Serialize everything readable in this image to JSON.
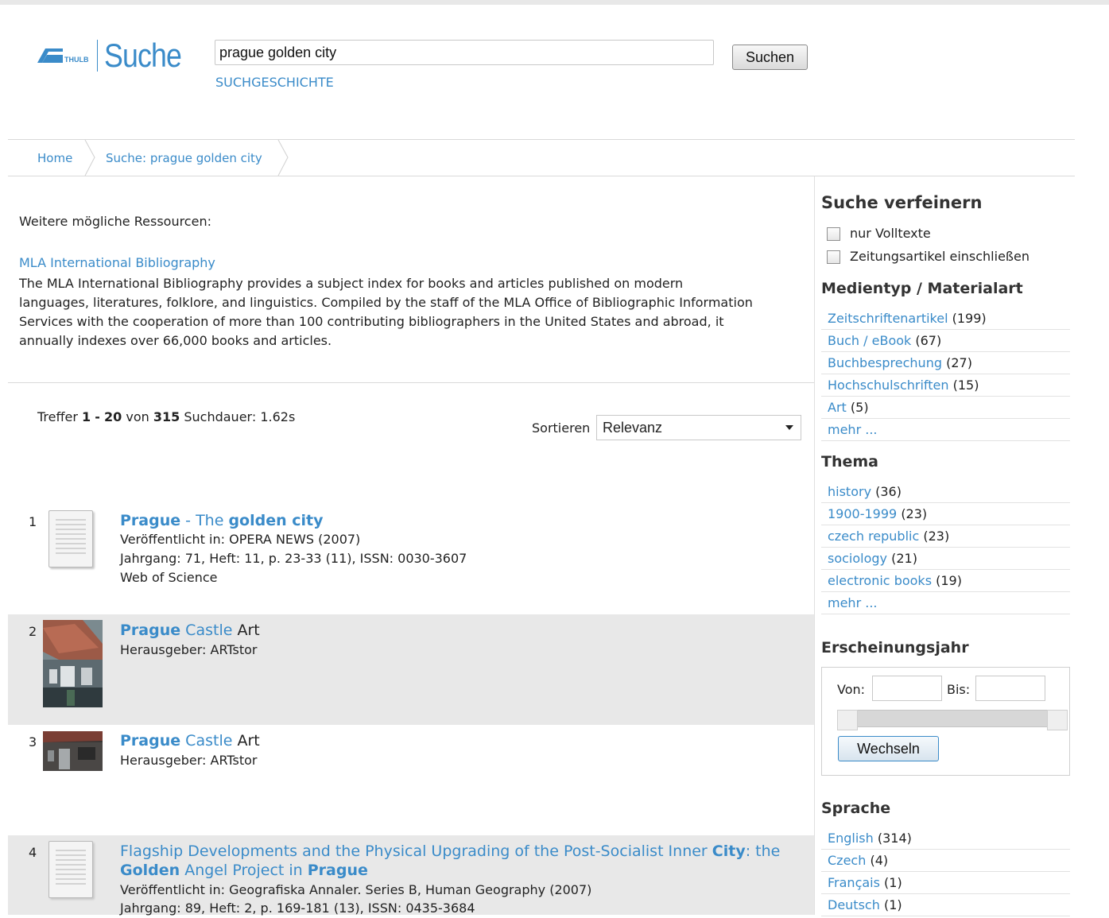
{
  "header": {
    "logo_brand": "THULB",
    "logo_text": "Suche",
    "search_value": "prague golden city",
    "search_button": "Suchen",
    "history_link": "SUCHGESCHICHTE"
  },
  "breadcrumb": [
    "Home",
    "Suche: prague golden city"
  ],
  "resources": {
    "heading": "Weitere mögliche Ressourcen:",
    "link": "MLA International Bibliography",
    "description": [
      "The MLA International Bibliography provides a subject index for books and articles published on modern",
      "languages, literatures, folklore, and linguistics. Compiled by the staff of the MLA Office of Bibliographic Information",
      "Services with the cooperation of more than 100 contributing bibliographers in the United States and abroad, it",
      "annually indexes over 66,000 books and articles."
    ]
  },
  "results_info": {
    "label": "Treffer",
    "from": "1",
    "dash": "-",
    "to": "20",
    "of_label": "von",
    "total": "315",
    "duration_label": "Suchdauer:",
    "duration": "1.62s",
    "sort_label": "Sortieren",
    "sort_value": "Relevanz"
  },
  "results": [
    {
      "num": "1",
      "thumb": "document-icon",
      "title": [
        {
          "text": "Prague",
          "style": "bold"
        },
        {
          "text": " - The ",
          "style": "link"
        },
        {
          "text": "golden city",
          "style": "bold"
        }
      ],
      "lines": [
        "Veröffentlicht in: OPERA NEWS (2007)",
        "Jahrgang: 71, Heft: 11, p. 23-33 (11), ISSN: 0030-3607",
        "Web of Science"
      ]
    },
    {
      "num": "2",
      "thumb": "prague-castle-photo",
      "title": [
        {
          "text": "Prague",
          "style": "bold"
        },
        {
          "text": " Castle",
          "style": "link"
        },
        {
          "text": " Art",
          "style": "plain"
        }
      ],
      "lines": [
        "Herausgeber: ARTstor"
      ]
    },
    {
      "num": "3",
      "thumb": "prague-castle-photo",
      "title": [
        {
          "text": "Prague",
          "style": "bold"
        },
        {
          "text": " Castle",
          "style": "link"
        },
        {
          "text": " Art",
          "style": "plain"
        }
      ],
      "lines": [
        "Herausgeber: ARTstor"
      ]
    },
    {
      "num": "4",
      "thumb": "document-icon",
      "title_line1": [
        {
          "text": "Flagship Developments and the Physical Upgrading of the Post-Socialist Inner ",
          "style": "link"
        },
        {
          "text": "City",
          "style": "bold"
        },
        {
          "text": ": the",
          "style": "link"
        }
      ],
      "title_line2": [
        {
          "text": "Golden",
          "style": "bold"
        },
        {
          "text": " Angel Project in ",
          "style": "link"
        },
        {
          "text": "Prague",
          "style": "bold"
        }
      ],
      "lines": [
        "Veröffentlicht in: Geografiska Annaler. Series B, Human Geography (2007)",
        "Jahrgang: 89, Heft: 2, p. 169-181 (13), ISSN: 0435-3684"
      ]
    }
  ],
  "sidebar": {
    "refine_heading": "Suche verfeinern",
    "checkboxes": [
      "nur Volltexte",
      "Zeitungsartikel einschließen"
    ],
    "media_heading": "Medientyp / Materialart",
    "media": [
      {
        "label": "Zeitschriftenartikel",
        "count": "(199)"
      },
      {
        "label": "Buch / eBook",
        "count": "(67)"
      },
      {
        "label": "Buchbesprechung",
        "count": "(27)"
      },
      {
        "label": "Hochschulschriften",
        "count": "(15)"
      },
      {
        "label": "Art",
        "count": "(5)"
      },
      {
        "label": "mehr ...",
        "count": ""
      }
    ],
    "topic_heading": "Thema",
    "topics": [
      {
        "label": "history",
        "count": "(36)"
      },
      {
        "label": "1900-1999",
        "count": "(23)"
      },
      {
        "label": "czech republic",
        "count": "(23)"
      },
      {
        "label": "sociology",
        "count": "(21)"
      },
      {
        "label": "electronic books",
        "count": "(19)"
      },
      {
        "label": "mehr ...",
        "count": ""
      }
    ],
    "year_heading": "Erscheinungsjahr",
    "year_from_label": "Von:",
    "year_to_label": "Bis:",
    "year_from": "",
    "year_to": "",
    "year_button": "Wechseln",
    "language_heading": "Sprache",
    "languages": [
      {
        "label": "English",
        "count": "(314)"
      },
      {
        "label": "Czech",
        "count": "(4)"
      },
      {
        "label": "Français",
        "count": "(1)"
      },
      {
        "label": "Deutsch",
        "count": "(1)"
      }
    ]
  },
  "colors": {
    "link": "#3a8bc9",
    "alt_row": "#e8e8e8"
  }
}
